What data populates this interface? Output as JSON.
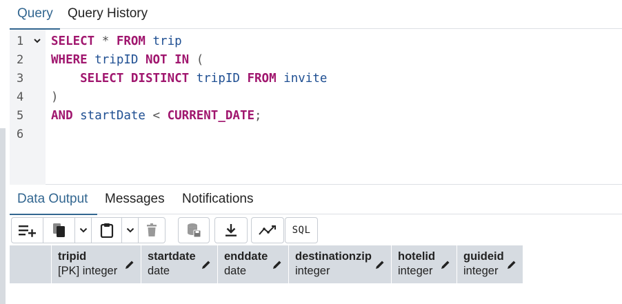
{
  "query_tabs": [
    "Query",
    "Query History"
  ],
  "editor": {
    "line_numbers": [
      "1",
      "2",
      "3",
      "4",
      "5",
      "6"
    ],
    "fold_icon": "chevron-down-icon",
    "lines": [
      [
        {
          "t": "SELECT",
          "c": "kw"
        },
        {
          "t": " * ",
          "c": "op"
        },
        {
          "t": "FROM",
          "c": "kw"
        },
        {
          "t": " trip",
          "c": "id"
        }
      ],
      [
        {
          "t": "WHERE",
          "c": "kw"
        },
        {
          "t": " tripID ",
          "c": "id"
        },
        {
          "t": "NOT IN",
          "c": "kw"
        },
        {
          "t": " (",
          "c": "op"
        }
      ],
      [
        {
          "t": "    SELECT DISTINCT",
          "c": "kw"
        },
        {
          "t": " tripID ",
          "c": "id"
        },
        {
          "t": "FROM",
          "c": "kw"
        },
        {
          "t": " invite",
          "c": "id"
        }
      ],
      [
        {
          "t": ")",
          "c": "op"
        }
      ],
      [
        {
          "t": "AND",
          "c": "kw"
        },
        {
          "t": " startDate ",
          "c": "id"
        },
        {
          "t": "< ",
          "c": "op"
        },
        {
          "t": "CURRENT_DATE",
          "c": "kw"
        },
        {
          "t": ";",
          "c": "op"
        }
      ],
      []
    ]
  },
  "output_tabs": [
    "Data Output",
    "Messages",
    "Notifications"
  ],
  "toolbar": {
    "sql_label": "SQL",
    "icons": [
      "add-row-icon",
      "copy-icon",
      "chevron-down-icon",
      "paste-icon",
      "chevron-down-icon",
      "delete-icon",
      "save-data-icon",
      "download-icon",
      "graph-icon",
      "sql-icon"
    ]
  },
  "columns": [
    {
      "name": "tripid",
      "type": "[PK] integer"
    },
    {
      "name": "startdate",
      "type": "date"
    },
    {
      "name": "enddate",
      "type": "date"
    },
    {
      "name": "destinationzip",
      "type": "integer"
    },
    {
      "name": "hotelid",
      "type": "integer"
    },
    {
      "name": "guideid",
      "type": "integer"
    }
  ],
  "colors": {
    "accent": "#326690",
    "keyword": "#a0166e",
    "identifier": "#1f4f92",
    "header_bg": "#d6dbe1"
  }
}
